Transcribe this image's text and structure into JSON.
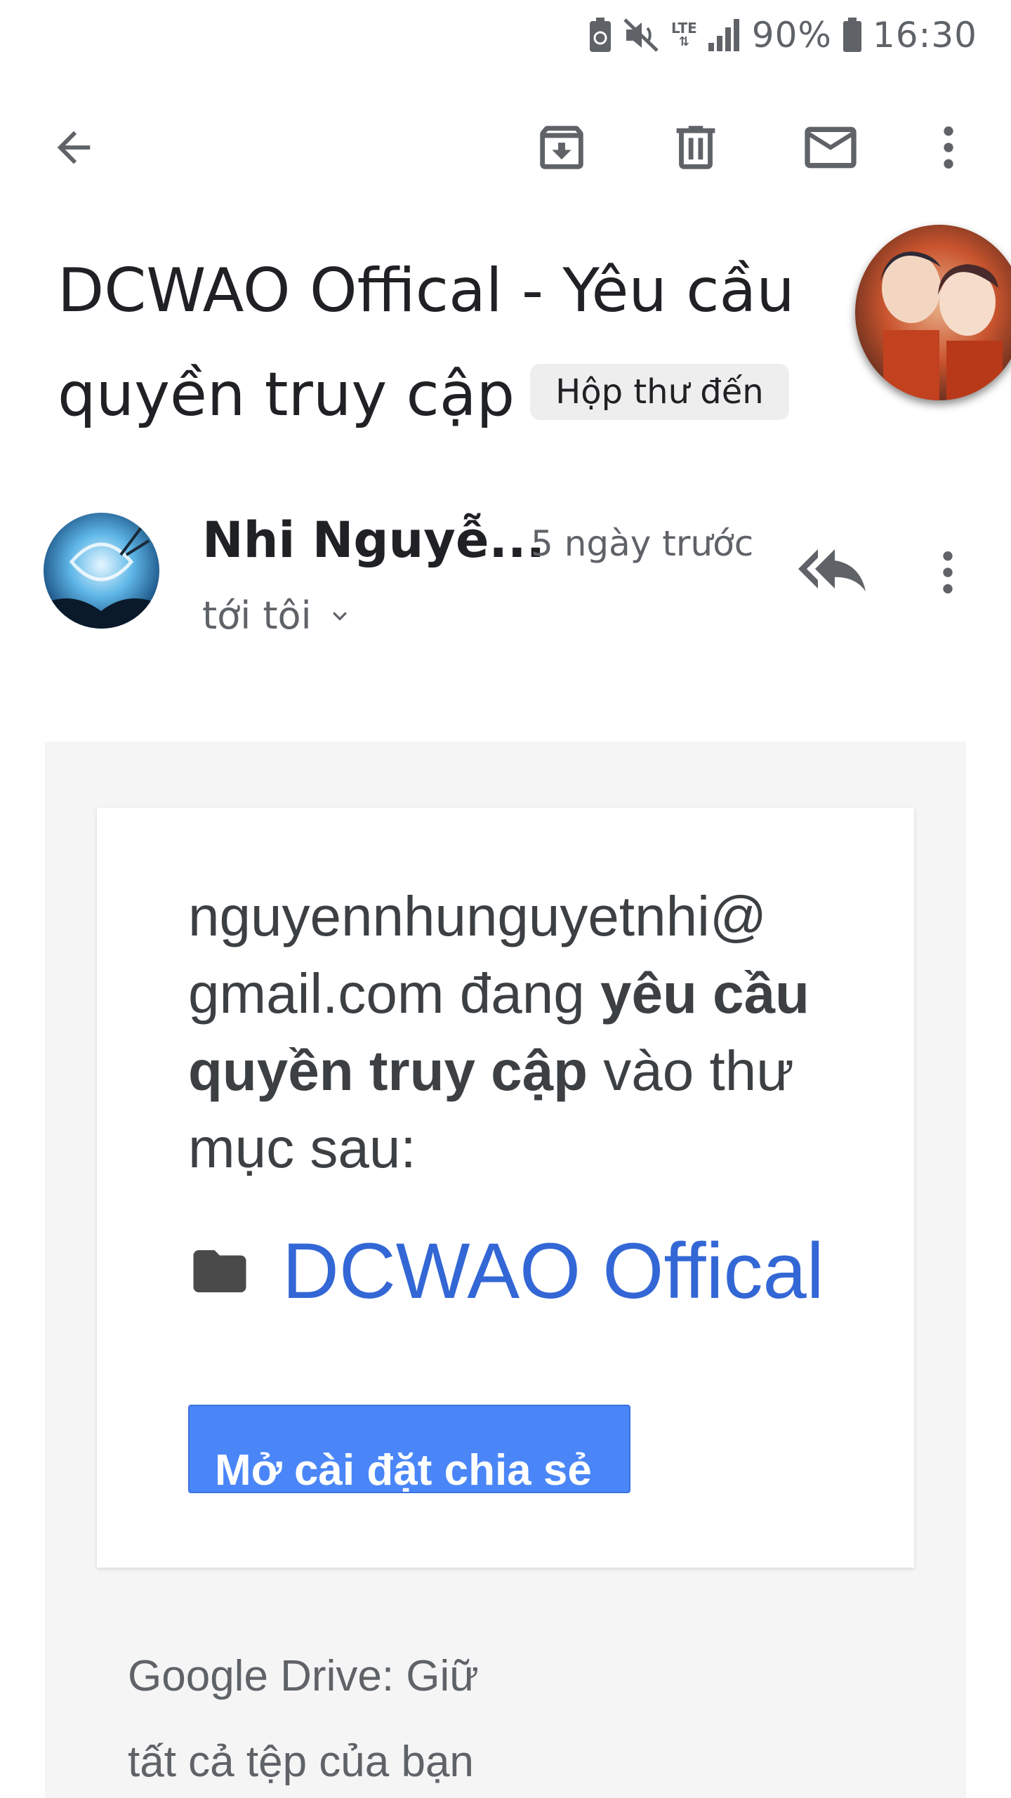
{
  "status_bar": {
    "battery_percent": "90%",
    "time": "16:30",
    "network": "LTE",
    "icons": [
      "battery-saver-icon",
      "mute-icon",
      "lte-icon",
      "signal-icon",
      "battery-icon"
    ]
  },
  "app_bar": {
    "icons": [
      "back-arrow-icon",
      "archive-icon",
      "delete-icon",
      "mark-unread-icon",
      "more-vert-icon"
    ]
  },
  "email": {
    "subject_line1": "DCWAO Offical - Yêu cầu",
    "subject_line2": "quyền truy cập",
    "label": "Hộp thư đến",
    "sender_name": "Nhi Nguyễ...",
    "time": "5 ngày trước",
    "recipient": "tới tôi",
    "body": {
      "request_prefix": "nguyenn​hunguyetnhi@ gmail.com đang ",
      "request_bold": "yêu cầu quyền truy cập",
      "request_suffix": " vào thư mục sau:",
      "folder_name": "DCWAO Offical",
      "button_label": "Mở cài đặt chia sẻ",
      "promo_line1": "Google Drive: Giữ",
      "promo_line2": "tất cả tệp của bạn"
    }
  },
  "colors": {
    "link_blue": "#3367d6",
    "button_blue": "#4a86f7",
    "body_background": "#f5f5f5",
    "label_chip": "#eeeeee"
  }
}
